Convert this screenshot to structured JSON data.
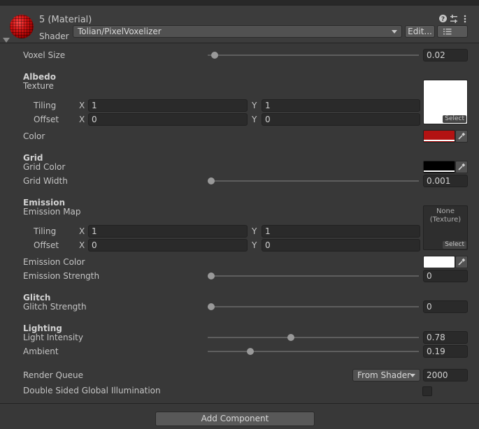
{
  "header": {
    "title": "5 (Material)",
    "shader_label": "Shader",
    "shader_value": "Tolian/PixelVoxelizer",
    "edit_button": "Edit...",
    "list_icon": "☰"
  },
  "voxel_size": {
    "label": "Voxel Size",
    "value": "0.02",
    "level": 0.02
  },
  "albedo": {
    "heading": "Albedo",
    "texture_label": "Texture",
    "select_label": "Select",
    "tiling_label": "Tiling",
    "offset_label": "Offset",
    "tiling_x": "1",
    "tiling_y": "1",
    "offset_x": "0",
    "offset_y": "0",
    "axis_x": "X",
    "axis_y": "Y",
    "color_label": "Color",
    "color_value": "#b31212"
  },
  "grid": {
    "heading": "Grid",
    "color_label": "Grid Color",
    "color_value": "#000000",
    "width_label": "Grid Width",
    "width_value": "0.001",
    "width_level": 0.0
  },
  "emission": {
    "heading": "Emission",
    "map_label": "Emission Map",
    "map_none": "None\n(Texture)",
    "none_line1": "None",
    "none_line2": "(Texture)",
    "select_label": "Select",
    "tiling_label": "Tiling",
    "offset_label": "Offset",
    "tiling_x": "1",
    "tiling_y": "1",
    "offset_x": "0",
    "offset_y": "0",
    "axis_x": "X",
    "axis_y": "Y",
    "color_label": "Emission Color",
    "color_value": "#ffffff",
    "strength_label": "Emission Strength",
    "strength_value": "0",
    "strength_level": 0.0
  },
  "glitch": {
    "heading": "Glitch",
    "strength_label": "Glitch Strength",
    "strength_value": "0",
    "strength_level": 0.0
  },
  "lighting": {
    "heading": "Lighting",
    "intensity_label": "Light Intensity",
    "intensity_value": "0.78",
    "intensity_level": 0.39,
    "ambient_label": "Ambient",
    "ambient_value": "0.19",
    "ambient_level": 0.19
  },
  "render_queue": {
    "label": "Render Queue",
    "mode": "From Shader",
    "value": "2000"
  },
  "double_sided_gi": {
    "label": "Double Sided Global Illumination",
    "checked": false
  },
  "add_component": "Add Component"
}
